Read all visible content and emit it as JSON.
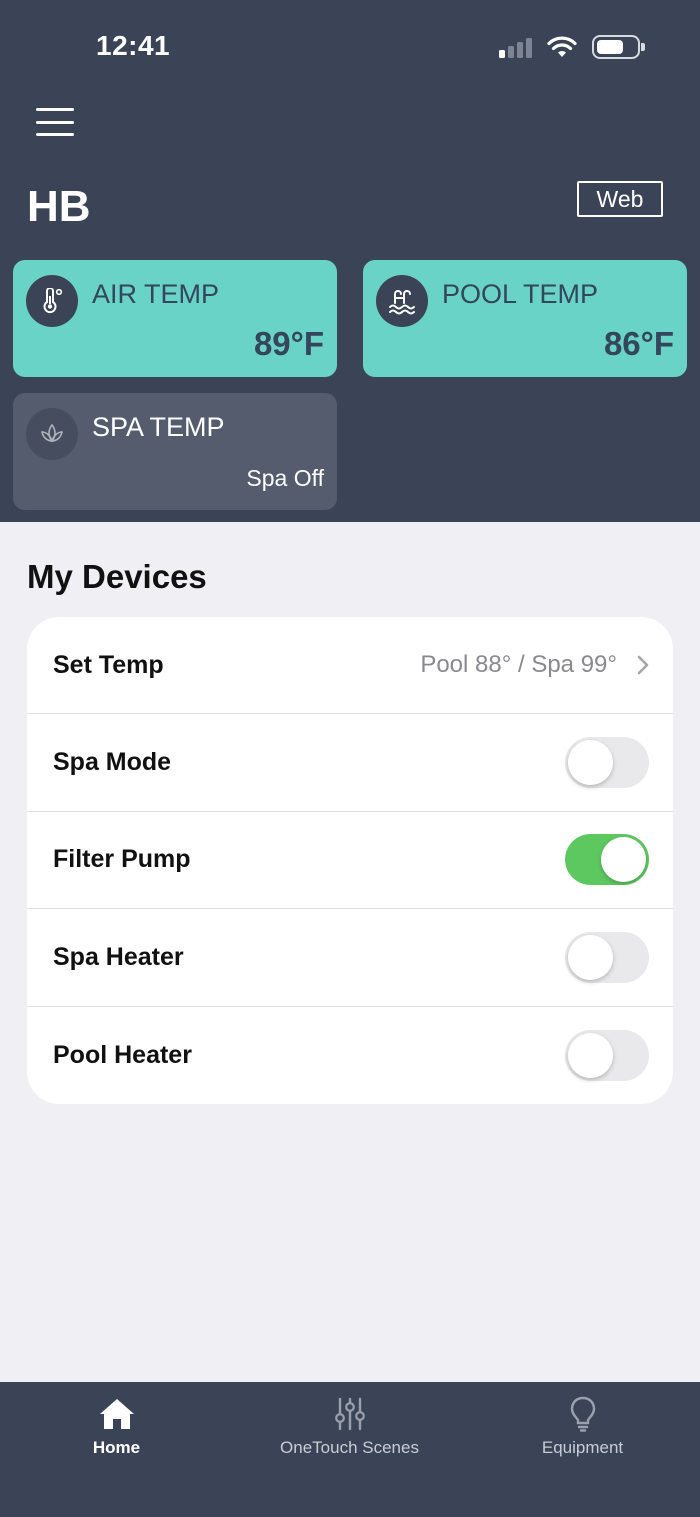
{
  "status_bar": {
    "time": "12:41"
  },
  "header": {
    "site_name": "HB",
    "web_label": "Web"
  },
  "temp_cards": {
    "air": {
      "label": "AIR TEMP",
      "value": "89°F",
      "icon": "thermometer-icon"
    },
    "pool": {
      "label": "POOL TEMP",
      "value": "86°F",
      "icon": "pool-ladder-icon"
    },
    "spa": {
      "label": "SPA TEMP",
      "value": "Spa Off",
      "icon": "lotus-icon"
    }
  },
  "devices": {
    "title": "My Devices",
    "set_temp": {
      "label": "Set Temp",
      "value": "Pool 88° / Spa 99°"
    },
    "items": [
      {
        "label": "Spa Mode",
        "on": false
      },
      {
        "label": "Filter Pump",
        "on": true
      },
      {
        "label": "Spa Heater",
        "on": false
      },
      {
        "label": "Pool Heater",
        "on": false
      }
    ]
  },
  "tabbar": {
    "tabs": [
      {
        "label": "Home",
        "icon": "home-icon",
        "active": true
      },
      {
        "label": "OneTouch Scenes",
        "icon": "sliders-icon",
        "active": false
      },
      {
        "label": "Equipment",
        "icon": "lightbulb-icon",
        "active": false
      }
    ]
  },
  "colors": {
    "header_bg": "#3b4456",
    "card_teal": "#69d3c7",
    "card_gray": "#545c6d",
    "toggle_on": "#5ec860",
    "page_bg": "#efeff4"
  }
}
